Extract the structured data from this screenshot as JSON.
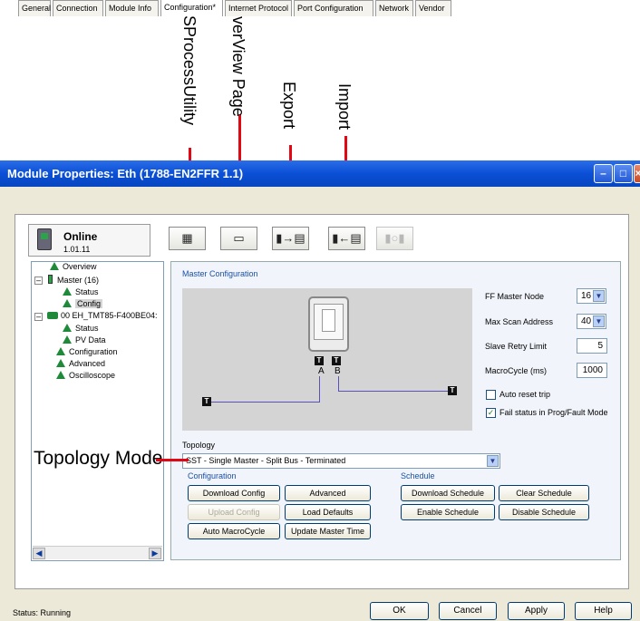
{
  "annotations": {
    "hsprocess": "HSProcessUtility",
    "overview": "OverView Page",
    "export": "Export",
    "import": "Import",
    "topology_mode": "Topology Mode"
  },
  "window": {
    "title": "Module Properties: Eth (1788-EN2FFR 1.1)",
    "controls": [
      "minimize-icon",
      "maximize-icon",
      "close-icon"
    ]
  },
  "tabs": [
    "General",
    "Connection",
    "Module Info",
    "Configuration*",
    "Internet Protocol",
    "Port Configuration",
    "Network",
    "Vendor"
  ],
  "active_tab": "Configuration*",
  "online": {
    "title": "Online",
    "version": "1.01.11"
  },
  "toolbar": {
    "icons": [
      "hsprocessutility-icon",
      "overview-page-icon",
      "export-icon",
      "import-icon",
      "disabled-tool-icon"
    ]
  },
  "tree": {
    "items": [
      {
        "label": "Overview"
      },
      {
        "label": "Master (16)"
      },
      {
        "label": "Status"
      },
      {
        "label": "Config"
      },
      {
        "label": "00 EH_TMT85-F400BE04:"
      },
      {
        "label": "Status"
      },
      {
        "label": "PV Data"
      },
      {
        "label": "Configuration"
      },
      {
        "label": "Advanced"
      },
      {
        "label": "Oscilloscope"
      }
    ],
    "selected": "Config"
  },
  "master": {
    "title": "Master Configuration",
    "port_a": "A",
    "port_b": "B",
    "terminator": "T",
    "ff_master_node_label": "FF Master Node",
    "ff_master_node_value": "16",
    "max_scan_label": "Max Scan Address",
    "max_scan_value": "40",
    "slave_retry_label": "Slave Retry Limit",
    "slave_retry_value": "5",
    "macrocycle_label": "MacroCycle (ms)",
    "macrocycle_value": "1000",
    "auto_reset_label": "Auto reset trip",
    "auto_reset_checked": false,
    "fail_status_label": "Fail status in Prog/Fault Mode",
    "fail_status_checked": true,
    "topology_label": "Topology",
    "topology_value": "SST  -  Single Master - Split Bus - Terminated"
  },
  "configuration": {
    "title": "Configuration",
    "download_config": "Download Config",
    "advanced": "Advanced",
    "upload_config": "Upload Config",
    "load_defaults": "Load Defaults",
    "auto_macrocycle": "Auto MacroCycle",
    "update_master_time": "Update Master Time"
  },
  "schedule": {
    "title": "Schedule",
    "download_schedule": "Download Schedule",
    "clear_schedule": "Clear Schedule",
    "enable_schedule": "Enable Schedule",
    "disable_schedule": "Disable Schedule"
  },
  "status": {
    "text": "Status:  Running"
  },
  "dialog": {
    "ok": "OK",
    "cancel": "Cancel",
    "apply": "Apply",
    "help": "Help"
  },
  "colors": {
    "annotation": "#e30613",
    "titlebar": "#0a4fd6",
    "section_title": "#1a4fa6",
    "bus_line": "#5a52b8"
  }
}
